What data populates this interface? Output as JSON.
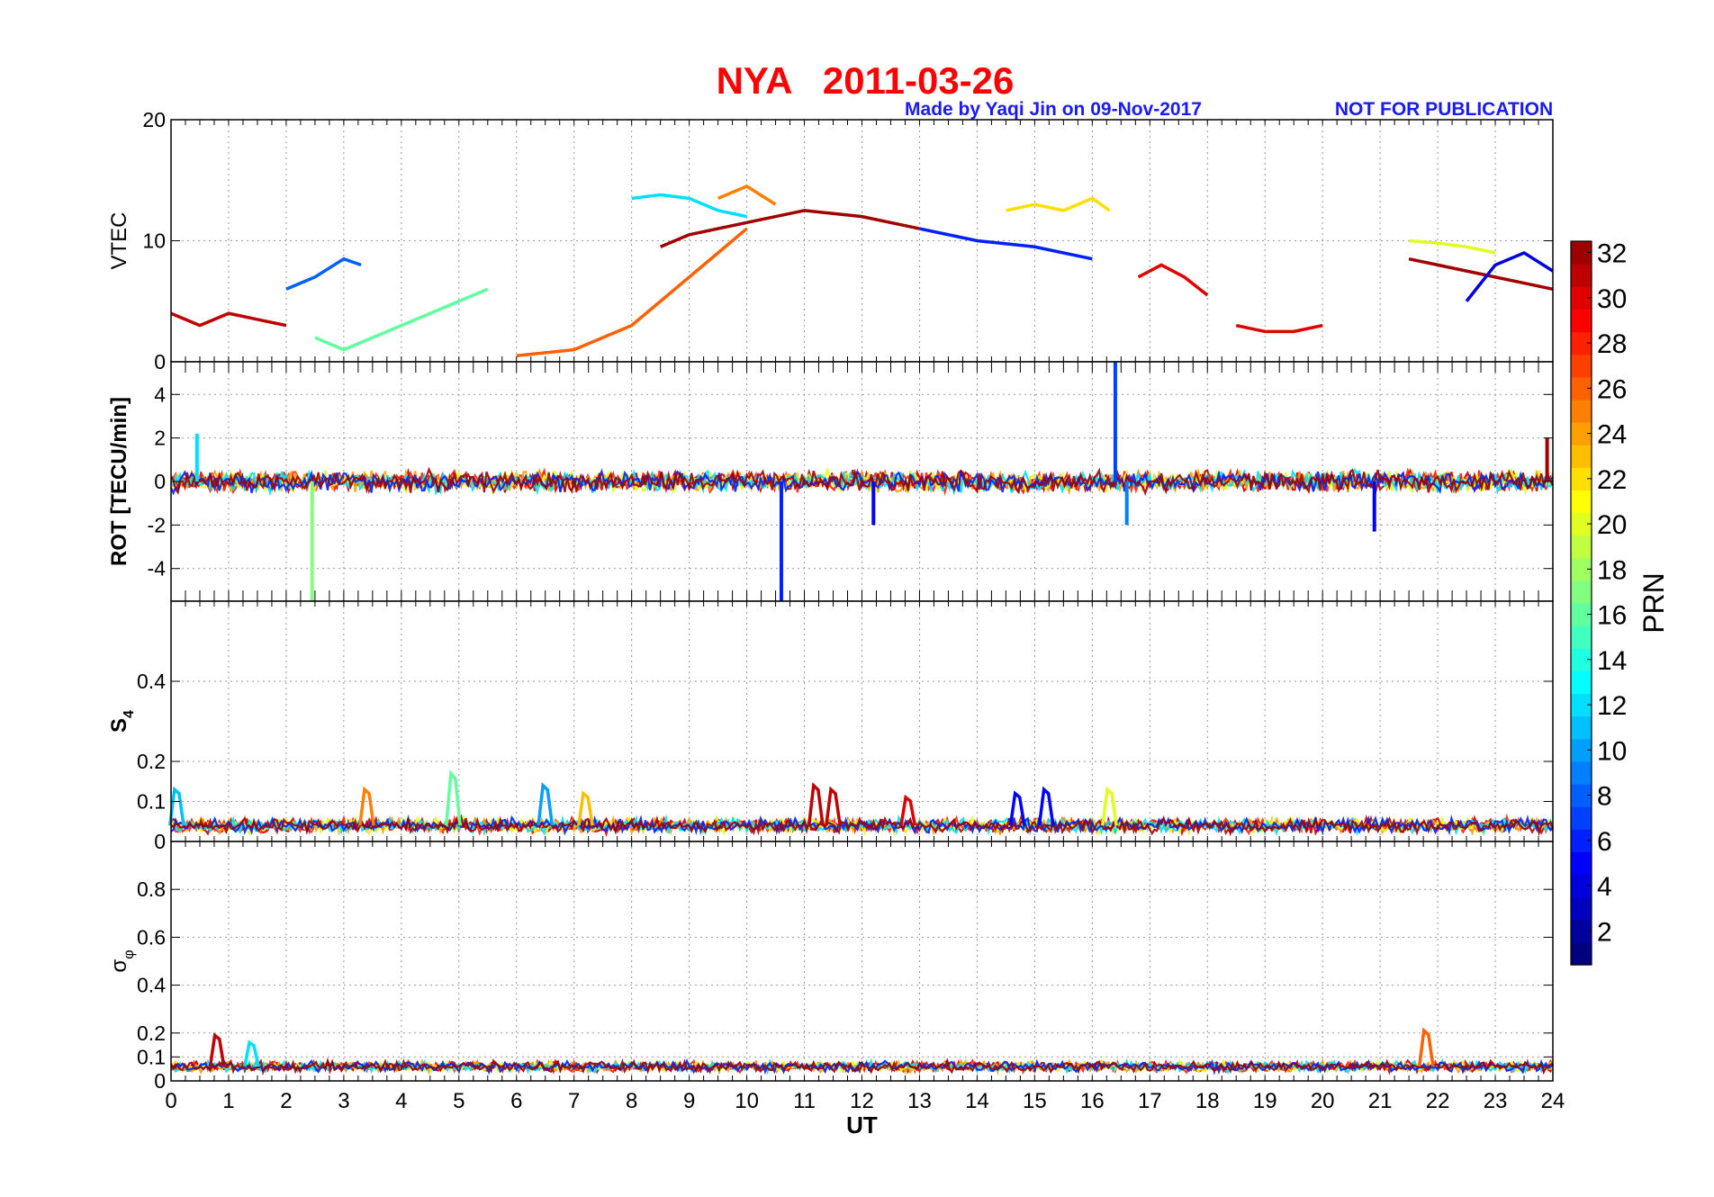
{
  "header": {
    "title": "NYA   2011-03-26",
    "title_color": "#ff0000",
    "credit": "Made by Yaqi Jin on 09-Nov-2017",
    "notice": "NOT FOR PUBLICATION",
    "note_color": "#1a1aff"
  },
  "chart_data": [
    {
      "type": "line",
      "panel": "vtec",
      "ylabel": "VTEC",
      "xlim": [
        0,
        24
      ],
      "ylim": [
        0,
        20
      ],
      "yticks": [
        0,
        10,
        20
      ],
      "grid": true,
      "description_of_series": "one line per GPS satellite PRN 1-32, color-coded by PRN",
      "series": [
        {
          "prn": 31,
          "x": [
            0.0,
            0.5,
            1.0,
            1.5,
            2.0
          ],
          "y": [
            4.0,
            3.0,
            4.0,
            3.5,
            3.0
          ]
        },
        {
          "prn": 16,
          "x": [
            2.5,
            3.0,
            3.5,
            4.5,
            5.5
          ],
          "y": [
            2.0,
            1.0,
            2.0,
            4.0,
            6.0
          ]
        },
        {
          "prn": 8,
          "x": [
            2.0,
            2.5,
            3.0,
            3.3
          ],
          "y": [
            6.0,
            7.0,
            8.5,
            8.0
          ]
        },
        {
          "prn": 26,
          "x": [
            6.0,
            7.0,
            8.0,
            9.0,
            10.0
          ],
          "y": [
            0.5,
            1.0,
            3.0,
            7.0,
            11.0
          ]
        },
        {
          "prn": 12,
          "x": [
            8.0,
            8.5,
            9.0,
            9.5,
            10.0
          ],
          "y": [
            13.5,
            13.8,
            13.5,
            12.5,
            12.0
          ]
        },
        {
          "prn": 32,
          "x": [
            8.5,
            9.0,
            10.0,
            11.0,
            12.0,
            13.0
          ],
          "y": [
            9.5,
            10.5,
            11.5,
            12.5,
            12.0,
            11.0
          ]
        },
        {
          "prn": 25,
          "x": [
            9.5,
            10.0,
            10.5
          ],
          "y": [
            13.5,
            14.5,
            13.0
          ]
        },
        {
          "prn": 22,
          "x": [
            14.5,
            15.0,
            15.5,
            16.0,
            16.3
          ],
          "y": [
            12.5,
            13.0,
            12.5,
            13.5,
            12.5
          ]
        },
        {
          "prn": 6,
          "x": [
            13.0,
            14.0,
            15.0,
            16.0
          ],
          "y": [
            11.0,
            10.0,
            9.5,
            8.5
          ]
        },
        {
          "prn": 30,
          "x": [
            16.8,
            17.2,
            17.6,
            18.0
          ],
          "y": [
            7.0,
            8.0,
            7.0,
            5.5
          ]
        },
        {
          "prn": 30,
          "x": [
            18.5,
            19.0,
            19.5,
            20.0
          ],
          "y": [
            3.0,
            2.5,
            2.5,
            3.0
          ]
        },
        {
          "prn": 32,
          "x": [
            21.5,
            22.0,
            22.5,
            23.0,
            23.5,
            24.0
          ],
          "y": [
            8.5,
            8.0,
            7.5,
            7.0,
            6.5,
            6.0
          ]
        },
        {
          "prn": 4,
          "x": [
            22.5,
            23.0,
            23.5,
            24.0
          ],
          "y": [
            5.0,
            8.0,
            9.0,
            7.5
          ]
        },
        {
          "prn": 20,
          "x": [
            21.5,
            22.0,
            22.5,
            23.0
          ],
          "y": [
            10.0,
            9.8,
            9.5,
            9.0
          ]
        }
      ]
    },
    {
      "type": "line",
      "panel": "rot",
      "ylabel": "ROT [TECU/min]",
      "xlim": [
        0,
        24
      ],
      "ylim": [
        -5.5,
        5.5
      ],
      "yticks": [
        -4,
        -2,
        0,
        2,
        4
      ],
      "grid": true,
      "noise_level": 0.4,
      "spikes": [
        {
          "prn": 17,
          "x": 2.45,
          "y": -5.5
        },
        {
          "prn": 6,
          "x": 10.6,
          "y": -5.5
        },
        {
          "prn": 7,
          "x": 16.4,
          "y": 5.5
        },
        {
          "prn": 9,
          "x": 16.6,
          "y": -2.0
        },
        {
          "prn": 5,
          "x": 20.9,
          "y": -2.3
        },
        {
          "prn": 5,
          "x": 12.2,
          "y": -2.0
        },
        {
          "prn": 12,
          "x": 0.45,
          "y": 2.2
        },
        {
          "prn": 32,
          "x": 23.9,
          "y": 2.0
        }
      ]
    },
    {
      "type": "line",
      "panel": "s4",
      "ylabel": "S4",
      "xlim": [
        0,
        24
      ],
      "ylim": [
        0,
        0.6
      ],
      "yticks": [
        0,
        0.1,
        0.2,
        0.4
      ],
      "grid": true,
      "baseline": 0.04,
      "peaks": [
        {
          "prn": 11,
          "x": 0.1,
          "y": 0.13
        },
        {
          "prn": 25,
          "x": 3.4,
          "y": 0.13
        },
        {
          "prn": 16,
          "x": 4.9,
          "y": 0.17
        },
        {
          "prn": 10,
          "x": 6.5,
          "y": 0.14
        },
        {
          "prn": 23,
          "x": 7.2,
          "y": 0.12
        },
        {
          "prn": 31,
          "x": 11.2,
          "y": 0.14
        },
        {
          "prn": 31,
          "x": 11.5,
          "y": 0.13
        },
        {
          "prn": 30,
          "x": 12.8,
          "y": 0.11
        },
        {
          "prn": 5,
          "x": 14.7,
          "y": 0.12
        },
        {
          "prn": 5,
          "x": 15.2,
          "y": 0.13
        },
        {
          "prn": 20,
          "x": 16.3,
          "y": 0.13
        }
      ]
    },
    {
      "type": "line",
      "panel": "sigma_phi",
      "ylabel": "σφ",
      "xlabel": "UT",
      "xlim": [
        0,
        24
      ],
      "ylim": [
        0,
        1
      ],
      "yticks": [
        0,
        0.1,
        0.2,
        0.4,
        0.6,
        0.8
      ],
      "xticks": [
        0,
        1,
        2,
        3,
        4,
        5,
        6,
        7,
        8,
        9,
        10,
        11,
        12,
        13,
        14,
        15,
        16,
        17,
        18,
        19,
        20,
        21,
        22,
        23,
        24
      ],
      "grid": true,
      "baseline": 0.06,
      "peaks": [
        {
          "prn": 31,
          "x": 0.8,
          "y": 0.19
        },
        {
          "prn": 12,
          "x": 1.4,
          "y": 0.16
        },
        {
          "prn": 26,
          "x": 21.8,
          "y": 0.21
        }
      ]
    }
  ],
  "colorbar": {
    "label": "PRN",
    "ticks": [
      2,
      4,
      6,
      8,
      10,
      12,
      14,
      16,
      18,
      20,
      22,
      24,
      26,
      28,
      30,
      32
    ],
    "range": [
      1,
      33
    ],
    "colormap": "jet"
  }
}
